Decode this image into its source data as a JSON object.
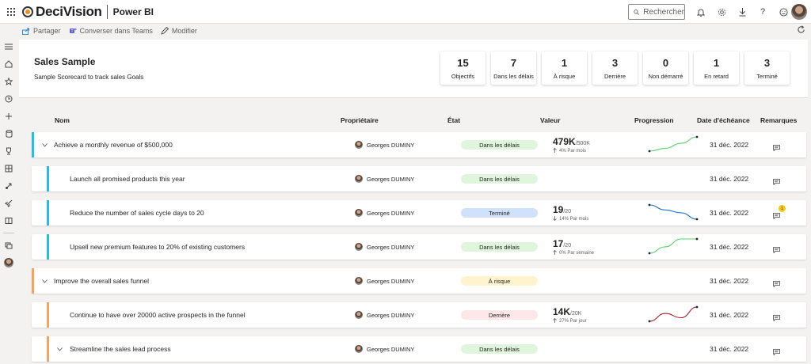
{
  "app": {
    "brand": "DeciVision",
    "product": "Power BI",
    "search_label": "Rechercher"
  },
  "toolbar": {
    "share": "Partager",
    "teams": "Converser dans Teams",
    "edit": "Modifier"
  },
  "scorecard": {
    "title": "Sales Sample",
    "subtitle": "Sample Scorecard to track sales Goals"
  },
  "stats": [
    {
      "value": "15",
      "label": "Objectifs"
    },
    {
      "value": "7",
      "label": "Dans les délais"
    },
    {
      "value": "1",
      "label": "À risque"
    },
    {
      "value": "3",
      "label": "Derrière"
    },
    {
      "value": "0",
      "label": "Non démarré"
    },
    {
      "value": "1",
      "label": "En retard"
    },
    {
      "value": "3",
      "label": "Terminé"
    }
  ],
  "columns": {
    "name": "Nom",
    "owner": "Propriétaire",
    "status": "État",
    "value": "Valeur",
    "progress": "Progression",
    "due": "Date d'échéance",
    "notes": "Remarques"
  },
  "colors": {
    "on_track": "#dff6dd",
    "at_risk": "#fff4ce",
    "behind": "#fde7e9",
    "completed": "#cfe1fb",
    "bar_blue": "#21c0e0",
    "bar_orange": "#f7a35c",
    "trend_green": "#59d36a",
    "trend_blue": "#1f6fc4",
    "trend_red": "#a4262c"
  },
  "goals": [
    {
      "name": "Achieve a monthly revenue of $500,000",
      "owner": "Georges DUMINY",
      "status": "Dans les délais",
      "status_color": "#dff6dd",
      "value": "479K",
      "target": "/500K",
      "change": "4% Par mois",
      "change_dir": "up",
      "due": "31 déc. 2022",
      "bar_color": "#21c0e0",
      "trend": [
        0,
        0.2,
        0.55,
        1
      ],
      "trend_color": "#59d36a",
      "expandable": true
    },
    {
      "name": "Launch all promised products this year",
      "owner": "Georges DUMINY",
      "status": "Dans les délais",
      "status_color": "#dff6dd",
      "value": "",
      "target": "",
      "change": "",
      "change_dir": "",
      "due": "31 déc. 2022",
      "bar_color": "#21c0e0",
      "trend": [],
      "trend_color": "",
      "expandable": false
    },
    {
      "name": "Reduce the number of sales cycle days to 20",
      "owner": "Georges DUMINY",
      "status": "Terminé",
      "status_color": "#cfe1fb",
      "value": "19",
      "target": "/20",
      "change": "14% Par mois",
      "change_dir": "down",
      "due": "31 déc. 2022",
      "bar_color": "#21c0e0",
      "trend": [
        1,
        0.65,
        0.45,
        0
      ],
      "trend_color": "#1f6fc4",
      "expandable": false,
      "note_badge": "1"
    },
    {
      "name": "Upsell new premium features to 20% of existing customers",
      "owner": "Georges DUMINY",
      "status": "Dans les délais",
      "status_color": "#dff6dd",
      "value": "17",
      "target": "/20",
      "change": "0% Par semaine",
      "change_dir": "up",
      "due": "31 déc. 2022",
      "bar_color": "#21c0e0",
      "trend": [
        0,
        0.45,
        1,
        1
      ],
      "trend_color": "#59d36a",
      "expandable": false
    },
    {
      "name": "Improve the overall sales funnel",
      "owner": "Georges DUMINY",
      "status": "À risque",
      "status_color": "#fff4ce",
      "value": "",
      "target": "",
      "change": "",
      "change_dir": "",
      "due": "31 déc. 2022",
      "bar_color": "#f7a35c",
      "trend": [],
      "trend_color": "",
      "expandable": true
    },
    {
      "name": "Continue to have over 20000 active prospects in the funnel",
      "owner": "Georges DUMINY",
      "status": "Derrière",
      "status_color": "#fde7e9",
      "value": "14K",
      "target": "/20K",
      "change": "27% Par jour",
      "change_dir": "up",
      "due": "31 déc. 2022",
      "bar_color": "#f7a35c",
      "trend": [
        0,
        0.55,
        0.25,
        1
      ],
      "trend_color": "#a4262c",
      "expandable": false
    },
    {
      "name": "Streamline the sales lead process",
      "owner": "Georges DUMINY",
      "status": "Dans les délais",
      "status_color": "#dff6dd",
      "value": "",
      "target": "",
      "change": "",
      "change_dir": "",
      "due": "31 déc. 2022",
      "bar_color": "#f7a35c",
      "trend": [],
      "trend_color": "",
      "expandable": true
    }
  ]
}
